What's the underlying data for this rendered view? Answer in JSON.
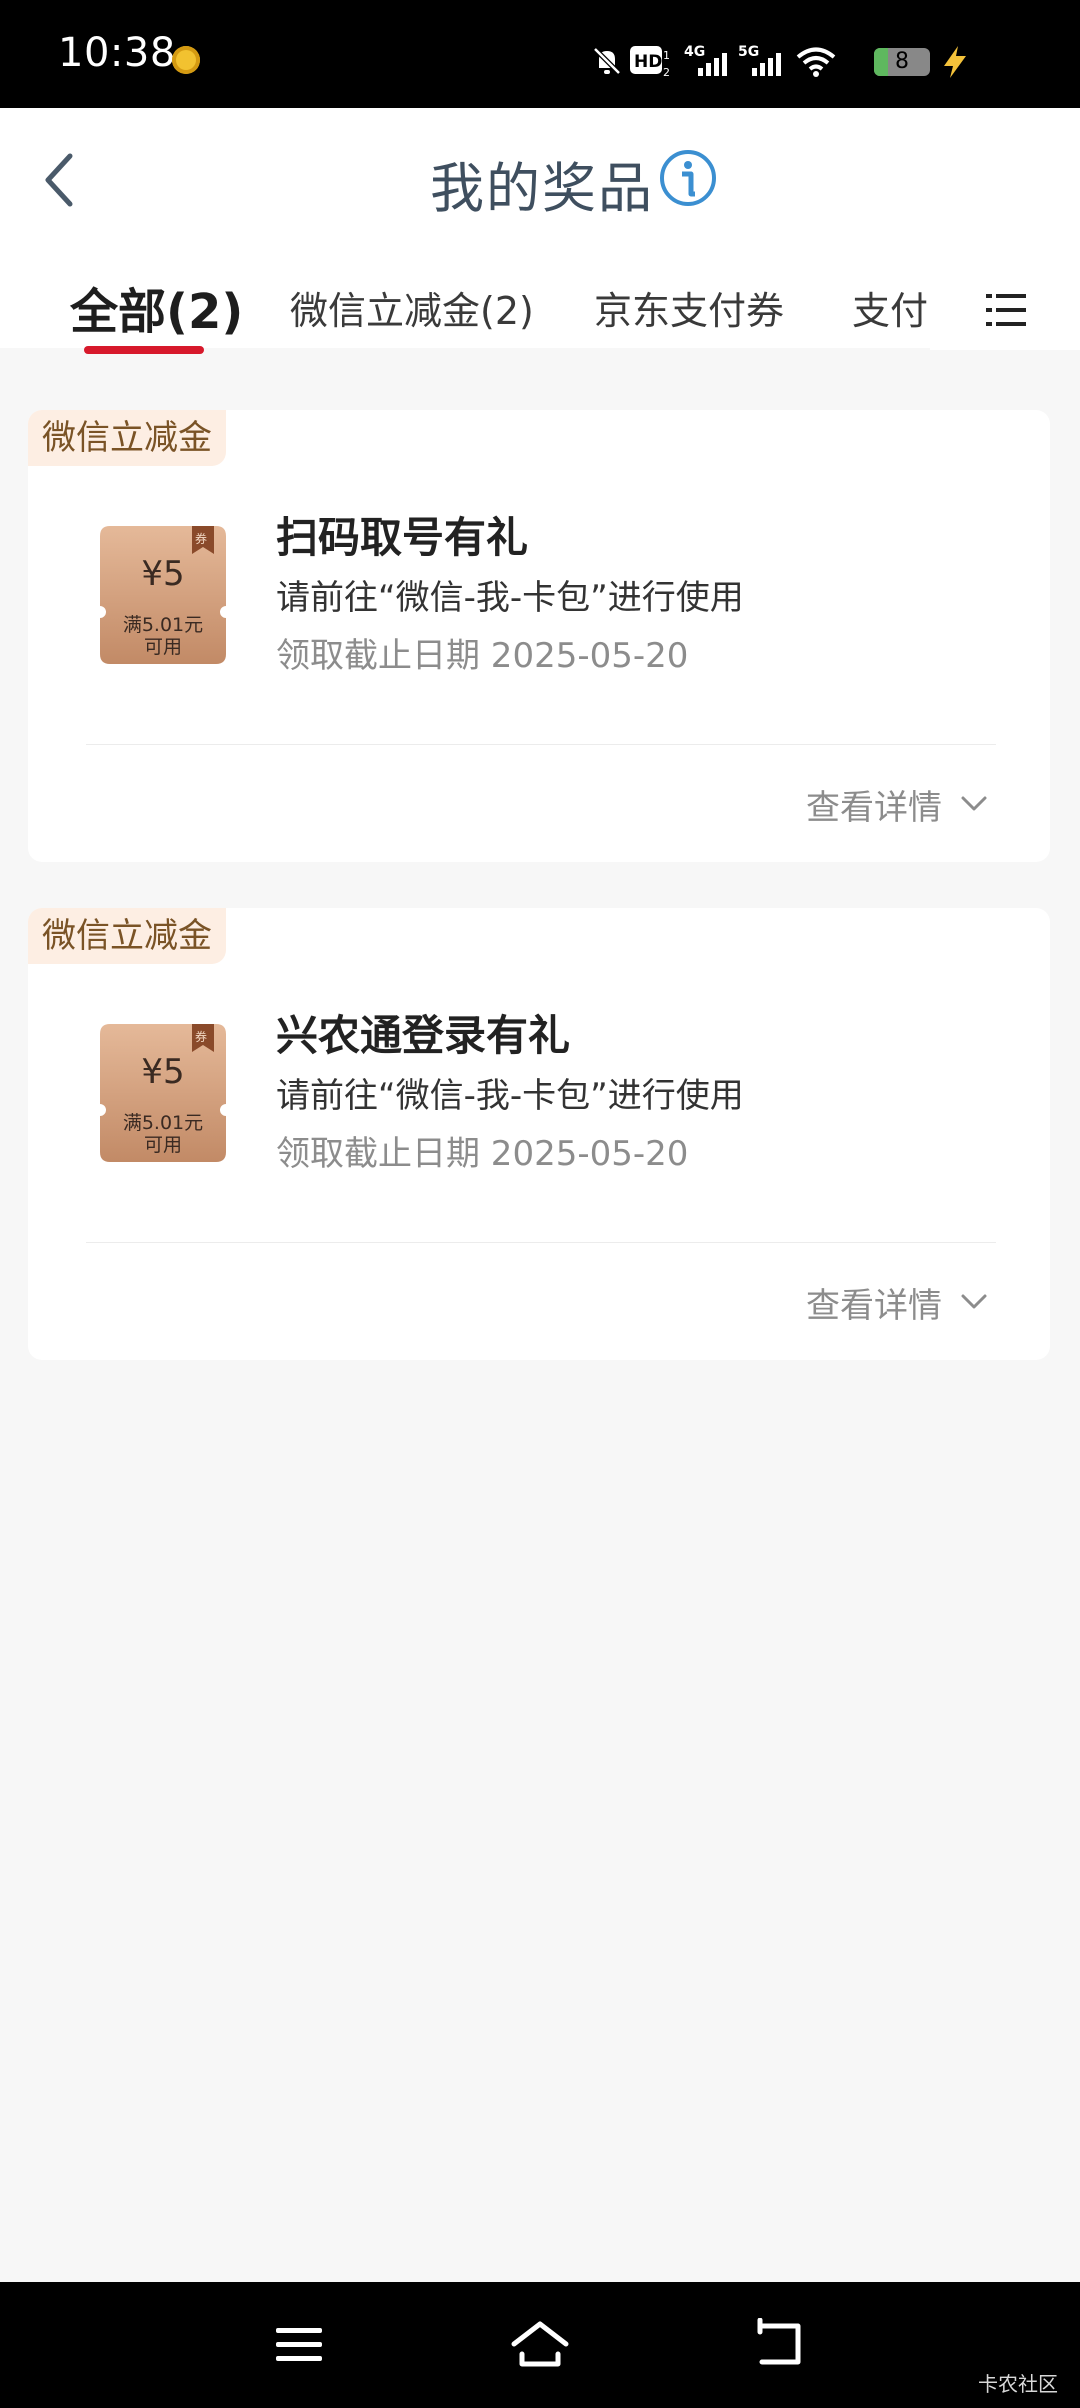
{
  "status_bar": {
    "time": "10:38",
    "battery": "8",
    "icons": [
      "coin-icon",
      "mute-icon",
      "hd-icon",
      "signal-4g-icon",
      "signal-5g-icon",
      "wifi-icon",
      "battery-icon",
      "charging-icon"
    ]
  },
  "header": {
    "title": "我的奖品",
    "info_icon": "info-icon",
    "back_icon": "back-arrow-icon"
  },
  "tabs": [
    {
      "label": "全部(2)",
      "active": true
    },
    {
      "label": "微信立减金(2)",
      "active": false
    },
    {
      "label": "京东支付券",
      "active": false
    },
    {
      "label": "支付宝",
      "active": false
    }
  ],
  "cards": [
    {
      "badge": "微信立减金",
      "amount": "¥5",
      "condition": "满5.01元可用",
      "ribbon": "券",
      "title": "扫码取号有礼",
      "desc": "请前往“微信-我-卡包”进行使用",
      "date": "领取截止日期 2025-05-20",
      "more": "查看详情"
    },
    {
      "badge": "微信立减金",
      "amount": "¥5",
      "condition": "满5.01元可用",
      "ribbon": "券",
      "title": "兴农通登录有礼",
      "desc": "请前往“微信-我-卡包”进行使用",
      "date": "领取截止日期 2025-05-20",
      "more": "查看详情"
    }
  ],
  "nav": {
    "icons": [
      "menu-nav-icon",
      "home-icon",
      "back-nav-icon"
    ]
  },
  "watermark": "卡农社区",
  "colors": {
    "accent": "#d7192b",
    "coupon": "#c9916e",
    "badge_bg": "#fdeee3",
    "badge_text": "#7a5326"
  }
}
